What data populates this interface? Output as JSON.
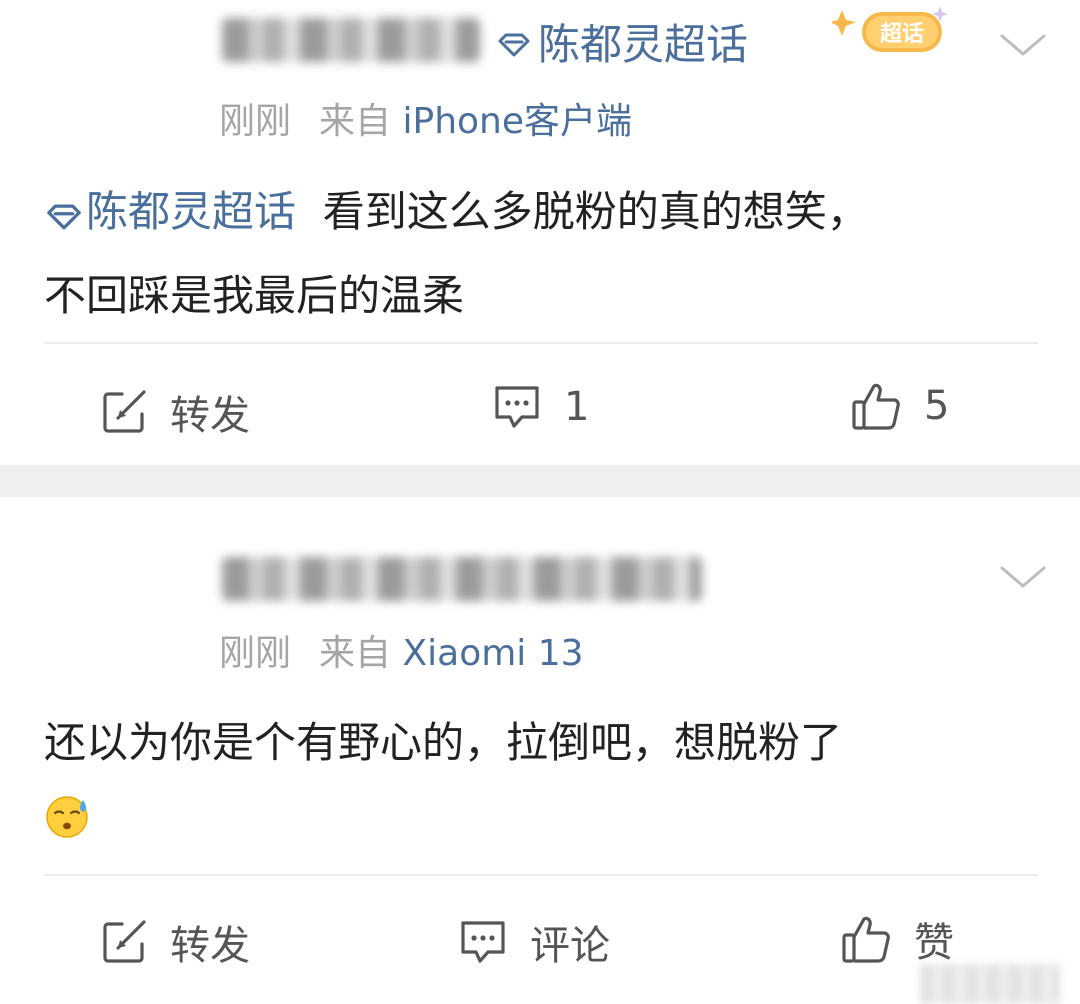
{
  "posts": [
    {
      "topic_badge": "陈都灵超话",
      "chaohua_badge": "超话",
      "time": "刚刚",
      "source_prefix": "来自",
      "source": "iPhone客户端",
      "topic_link": "陈都灵超话",
      "text_line1": "看到这么多脱粉的真的想笑，",
      "text_line2": "不回踩是我最后的温柔",
      "actions": {
        "repost": "转发",
        "comment": "1",
        "like": "5"
      }
    },
    {
      "time": "刚刚",
      "source_prefix": "来自",
      "source": "Xiaomi 13",
      "text_line1": "还以为你是个有野心的，拉倒吧，想脱粉了",
      "emoji": "sweat-face-emoji",
      "actions": {
        "repost": "转发",
        "comment": "评论",
        "like": "赞"
      }
    }
  ],
  "colors": {
    "link": "#4a6f9c",
    "meta": "#a5a5a5",
    "text": "#222222",
    "action": "#555555",
    "gap": "#efefef",
    "badge": "#f7b84b"
  },
  "icons": [
    "diamond-icon",
    "chevron-down-icon",
    "repost-icon",
    "comment-icon",
    "like-icon"
  ]
}
